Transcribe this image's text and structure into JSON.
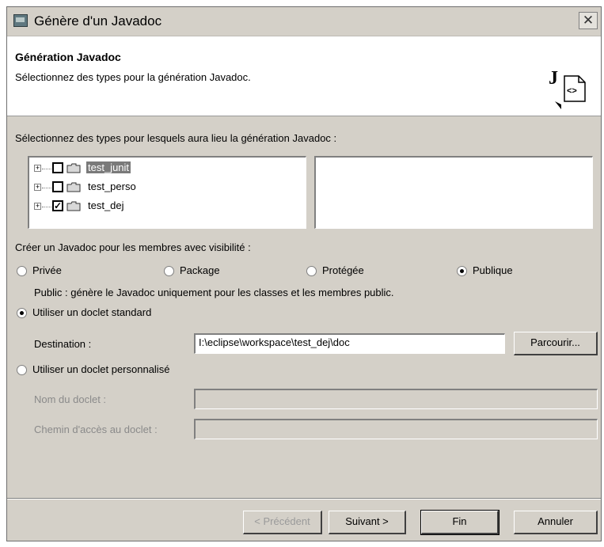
{
  "window": {
    "title": "Génère d'un Javadoc",
    "close_label": "✕"
  },
  "header": {
    "title": "Génération Javadoc",
    "description": "Sélectionnez des types pour la génération Javadoc."
  },
  "types_section": {
    "label": "Sélectionnez des types pour lesquels aura lieu la génération Javadoc :",
    "tree": [
      {
        "label": "test_junit",
        "checked": false,
        "selected": true
      },
      {
        "label": "test_perso",
        "checked": false,
        "selected": false
      },
      {
        "label": "test_dej",
        "checked": true,
        "selected": false
      }
    ]
  },
  "visibility": {
    "label": "Créer un Javadoc pour les membres avec visibilité :",
    "options": [
      "Privée",
      "Package",
      "Protégée",
      "Publique"
    ],
    "selected": "Publique",
    "hint": "Public : génère le Javadoc uniquement pour les classes et les membres public."
  },
  "standard_doclet": {
    "label": "Utiliser un doclet standard",
    "selected": true,
    "destination_label": "Destination :",
    "destination_value": "I:\\eclipse\\workspace\\test_dej\\doc",
    "browse_label": "Parcourir..."
  },
  "custom_doclet": {
    "label": "Utiliser un doclet personnalisé",
    "selected": false,
    "name_label": "Nom du doclet :",
    "name_value": "",
    "path_label": "Chemin d'accès au doclet :",
    "path_value": ""
  },
  "footer": {
    "previous_label": "< Précédent",
    "next_label": "Suivant >",
    "finish_label": "Fin",
    "cancel_label": "Annuler"
  }
}
